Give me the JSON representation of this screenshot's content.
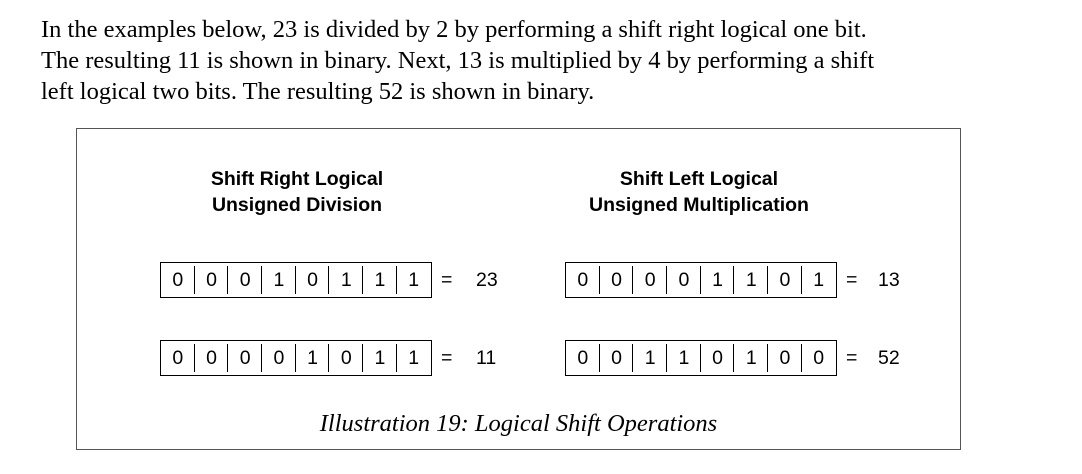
{
  "paragraph": {
    "lines": [
      "In the examples below, 23 is divided by 2 by performing a shift right logical one bit.",
      "The resulting 11 is shown in binary.  Next, 13 is multiplied by 4 by performing a shift",
      "left logical two bits.  The resulting 52 is shown in binary."
    ]
  },
  "figure": {
    "caption": "Illustration 19: Logical Shift Operations",
    "left_panel": {
      "title_line1": "Shift Right Logical",
      "title_line2": "Unsigned Division",
      "rows": [
        {
          "bits": [
            "0",
            "0",
            "0",
            "1",
            "0",
            "1",
            "1",
            "1"
          ],
          "equals": "=",
          "result": "23"
        },
        {
          "bits": [
            "0",
            "0",
            "0",
            "0",
            "1",
            "0",
            "1",
            "1"
          ],
          "equals": "=",
          "result": "11"
        }
      ]
    },
    "right_panel": {
      "title_line1": "Shift Left Logical",
      "title_line2": "Unsigned Multiplication",
      "rows": [
        {
          "bits": [
            "0",
            "0",
            "0",
            "0",
            "1",
            "1",
            "0",
            "1"
          ],
          "equals": "=",
          "result": "13"
        },
        {
          "bits": [
            "0",
            "0",
            "1",
            "1",
            "0",
            "1",
            "0",
            "0"
          ],
          "equals": "=",
          "result": "52"
        }
      ]
    }
  }
}
